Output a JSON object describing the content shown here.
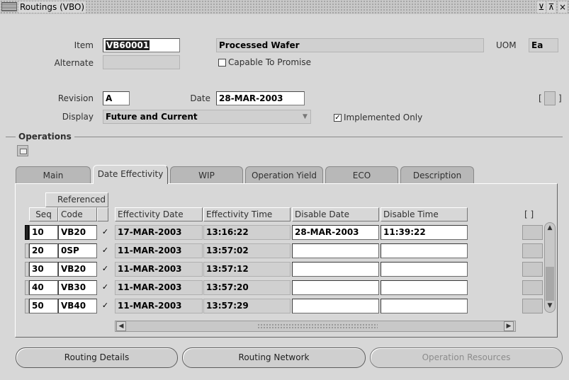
{
  "window": {
    "title": "Routings (VBO)",
    "controls": [
      "⊻",
      "⊼",
      "×"
    ]
  },
  "header": {
    "item_label": "Item",
    "item_value": "VB60001",
    "item_desc": "Processed Wafer",
    "uom_label": "UOM",
    "uom_value": "Ea",
    "alternate_label": "Alternate",
    "alternate_value": "",
    "capable_to_promise_label": "Capable To Promise",
    "capable_to_promise_checked": false,
    "revision_label": "Revision",
    "revision_value": "A",
    "date_label": "Date",
    "date_value": "28-MAR-2003",
    "display_label": "Display",
    "display_value": "Future and Current",
    "implemented_only_label": "Implemented Only",
    "implemented_only_checked": true,
    "flex_open": "[",
    "flex_close": "]"
  },
  "operations": {
    "section_title": "Operations",
    "tabs": [
      {
        "label": "Main",
        "active": false
      },
      {
        "label": "Date Effectivity",
        "active": true
      },
      {
        "label": "WIP",
        "active": false
      },
      {
        "label": "Operation Yield",
        "active": false
      },
      {
        "label": "ECO",
        "active": false
      },
      {
        "label": "Description",
        "active": false
      }
    ],
    "group_header": "Referenced",
    "columns": {
      "seq": "Seq",
      "code": "Code",
      "effectivity_date": "Effectivity Date",
      "effectivity_time": "Effectivity Time",
      "disable_date": "Disable Date",
      "disable_time": "Disable Time",
      "flex": "[ ]"
    },
    "rows": [
      {
        "seq": "10",
        "code": "VB20",
        "referenced": "✓",
        "effectivity_date": "17-MAR-2003",
        "effectivity_time": "13:16:22",
        "disable_date": "28-MAR-2003",
        "disable_time": "11:39:22",
        "current": true
      },
      {
        "seq": "20",
        "code": "0SP",
        "referenced": "✓",
        "effectivity_date": "11-MAR-2003",
        "effectivity_time": "13:57:02",
        "disable_date": "",
        "disable_time": "",
        "current": false
      },
      {
        "seq": "30",
        "code": "VB20",
        "referenced": "✓",
        "effectivity_date": "11-MAR-2003",
        "effectivity_time": "13:57:12",
        "disable_date": "",
        "disable_time": "",
        "current": false
      },
      {
        "seq": "40",
        "code": "VB30",
        "referenced": "✓",
        "effectivity_date": "11-MAR-2003",
        "effectivity_time": "13:57:20",
        "disable_date": "",
        "disable_time": "",
        "current": false
      },
      {
        "seq": "50",
        "code": "VB40",
        "referenced": "✓",
        "effectivity_date": "11-MAR-2003",
        "effectivity_time": "13:57:29",
        "disable_date": "",
        "disable_time": "",
        "current": false
      }
    ]
  },
  "buttons": {
    "routing_details": "Routing Details",
    "routing_network": "Routing Network",
    "operation_resources": "Operation Resources"
  }
}
